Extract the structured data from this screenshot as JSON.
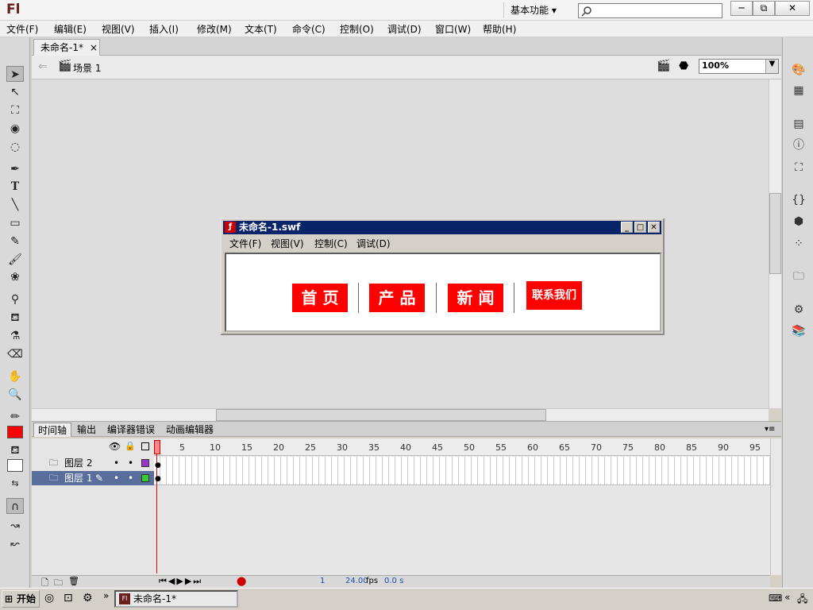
{
  "app": {
    "logo": "Fl",
    "workspace": "基本功能",
    "workspace_arrow": "▾"
  },
  "window_controls": {
    "minimize": "─",
    "restore": "⧉",
    "close": "✕"
  },
  "menubar": [
    "文件(F)",
    "编辑(E)",
    "视图(V)",
    "插入(I)",
    "修改(M)",
    "文本(T)",
    "命令(C)",
    "控制(O)",
    "调试(D)",
    "窗口(W)",
    "帮助(H)"
  ],
  "document": {
    "tab_label": "未命名-1*",
    "tab_close": "×",
    "scene_label": "场景 1",
    "zoom": "100%"
  },
  "swf_window": {
    "title": "未命名-1.swf",
    "menu": [
      "文件(F)",
      "视图(V)",
      "控制(C)",
      "调试(D)"
    ],
    "nav_buttons": [
      "首 页",
      "产 品",
      "新 闻",
      "联系我们"
    ],
    "button_color": "#ff0000"
  },
  "timeline": {
    "tabs": [
      "时间轴",
      "输出",
      "编译器错误",
      "动画编辑器"
    ],
    "ruler": [
      "1",
      "5",
      "10",
      "15",
      "20",
      "25",
      "30",
      "35",
      "40",
      "45",
      "50",
      "55",
      "60",
      "65",
      "70",
      "75",
      "80",
      "85",
      "90",
      "95"
    ],
    "layers": [
      {
        "name": "图层 2",
        "color": "#9933cc",
        "selected": false
      },
      {
        "name": "图层 1",
        "color": "#33cc33",
        "selected": true
      }
    ],
    "current_frame": "1",
    "fps": "24.00",
    "fps_unit": "fps",
    "time": "0.0 s"
  },
  "taskbar": {
    "start_label": "开始",
    "task_label": "未命名-1*",
    "chevron": "»"
  },
  "colors": {
    "stroke": "#000000",
    "fill": "#ff0000",
    "accent": "#0a246a"
  }
}
